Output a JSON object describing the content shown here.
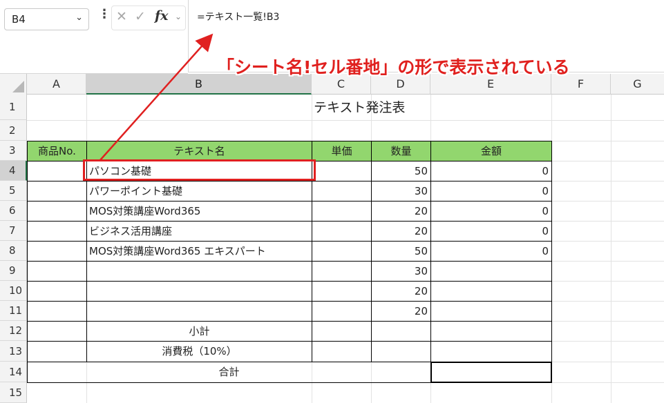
{
  "name_box": {
    "value": "B4"
  },
  "formula_bar": {
    "formula": "=テキスト一覧!B3",
    "cancel_glyph": "✕",
    "enter_glyph": "✓",
    "fx_label": "fx"
  },
  "annotation": {
    "text": "「シート名!セル番地」の形で表示されている",
    "color": "#e0201e"
  },
  "columns": [
    "A",
    "B",
    "C",
    "D",
    "E",
    "F",
    "G"
  ],
  "rows": [
    "1",
    "2",
    "3",
    "4",
    "5",
    "6",
    "7",
    "8",
    "9",
    "10",
    "11",
    "12",
    "13",
    "14",
    "15"
  ],
  "active_cell": {
    "column": "B",
    "row": "4"
  },
  "sheet": {
    "title": "テキスト発注表",
    "headers": {
      "a": "商品No.",
      "b": "テキスト名",
      "c": "単価",
      "d": "数量",
      "e": "金額"
    },
    "header_color": "#92d66e",
    "items": [
      {
        "a": "",
        "b": "パソコン基礎",
        "c": "",
        "d": "50",
        "e": "0"
      },
      {
        "a": "",
        "b": "パワーポイント基礎",
        "c": "",
        "d": "30",
        "e": "0"
      },
      {
        "a": "",
        "b": "MOS対策講座Word365",
        "c": "",
        "d": "20",
        "e": "0"
      },
      {
        "a": "",
        "b": "ビジネス活用講座",
        "c": "",
        "d": "20",
        "e": "0"
      },
      {
        "a": "",
        "b": "MOS対策講座Word365 エキスパート",
        "c": "",
        "d": "50",
        "e": "0"
      },
      {
        "a": "",
        "b": "",
        "c": "",
        "d": "30",
        "e": ""
      },
      {
        "a": "",
        "b": "",
        "c": "",
        "d": "20",
        "e": ""
      },
      {
        "a": "",
        "b": "",
        "c": "",
        "d": "20",
        "e": ""
      }
    ],
    "subtotal_label": "小計",
    "tax_label": "消費税（10%）",
    "total_label": "合計"
  }
}
